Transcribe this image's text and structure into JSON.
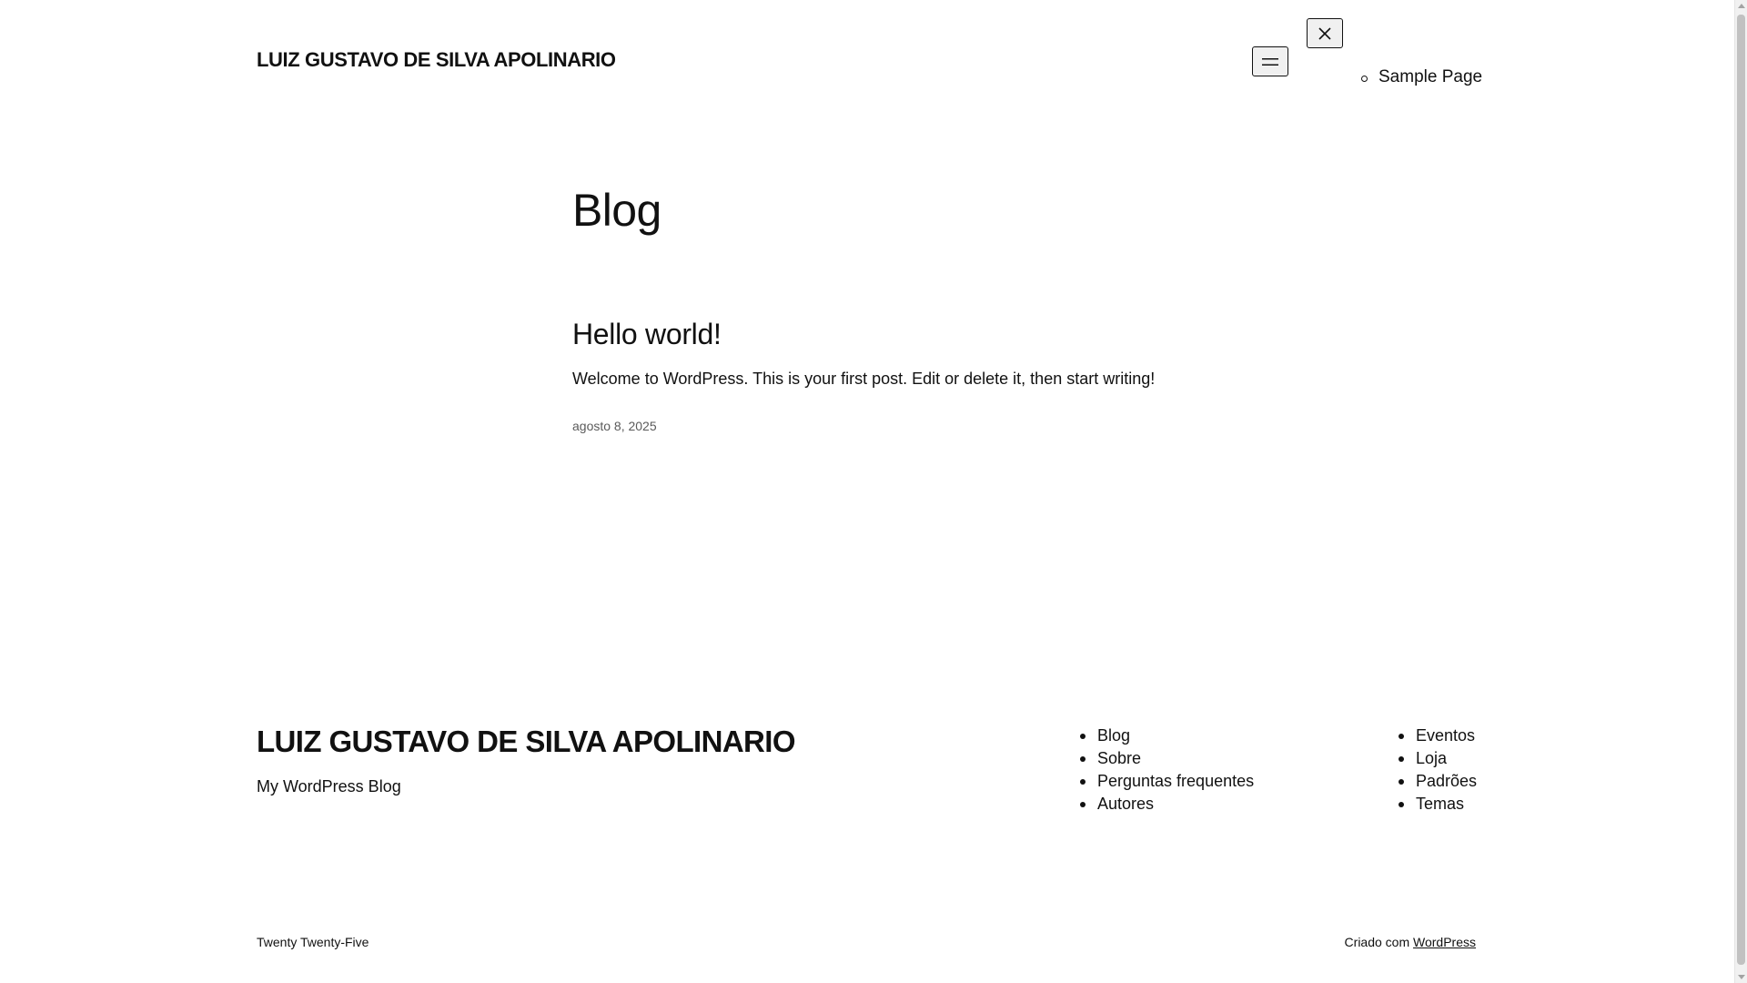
{
  "header": {
    "site_title": "LUIZ GUSTAVO DE SILVA APOLINARIO",
    "menu_open_icon": "hamburger-icon",
    "menu_close_icon": "close-icon",
    "nav_items": [
      {
        "label": "Sample Page"
      }
    ]
  },
  "main": {
    "heading": "Blog",
    "posts": [
      {
        "title": "Hello world!",
        "excerpt": "Welcome to WordPress. This is your first post. Edit or delete it, then start writing!",
        "date": "agosto 8, 2025"
      }
    ]
  },
  "footer": {
    "site_title": "LUIZ GUSTAVO DE SILVA APOLINARIO",
    "tagline": "My WordPress Blog",
    "nav_col_1": [
      {
        "label": "Blog"
      },
      {
        "label": "Sobre"
      },
      {
        "label": "Perguntas frequentes"
      },
      {
        "label": "Autores"
      }
    ],
    "nav_col_2": [
      {
        "label": "Eventos"
      },
      {
        "label": "Loja"
      },
      {
        "label": "Padrões"
      },
      {
        "label": "Temas"
      }
    ],
    "theme_credit": "Twenty Twenty-Five",
    "made_with_prefix": "Criado com ",
    "made_with_link": "WordPress"
  }
}
